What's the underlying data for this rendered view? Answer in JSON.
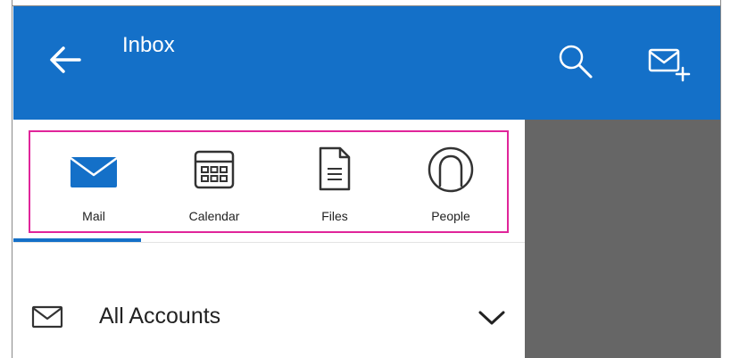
{
  "colors": {
    "header": "#1470c8",
    "highlight": "#e0259a",
    "overlay": "#666666"
  },
  "header": {
    "title": "Inbox",
    "back_icon": "arrow-left-icon",
    "search_icon": "search-icon",
    "compose_icon": "new-mail-icon"
  },
  "apps": [
    {
      "label": "Mail",
      "icon": "mail-icon",
      "active": true
    },
    {
      "label": "Calendar",
      "icon": "calendar-icon",
      "active": false
    },
    {
      "label": "Files",
      "icon": "file-icon",
      "active": false
    },
    {
      "label": "People",
      "icon": "person-icon",
      "active": false
    }
  ],
  "account": {
    "label": "All Accounts",
    "icon": "envelope-icon",
    "expand_icon": "chevron-down-icon"
  }
}
